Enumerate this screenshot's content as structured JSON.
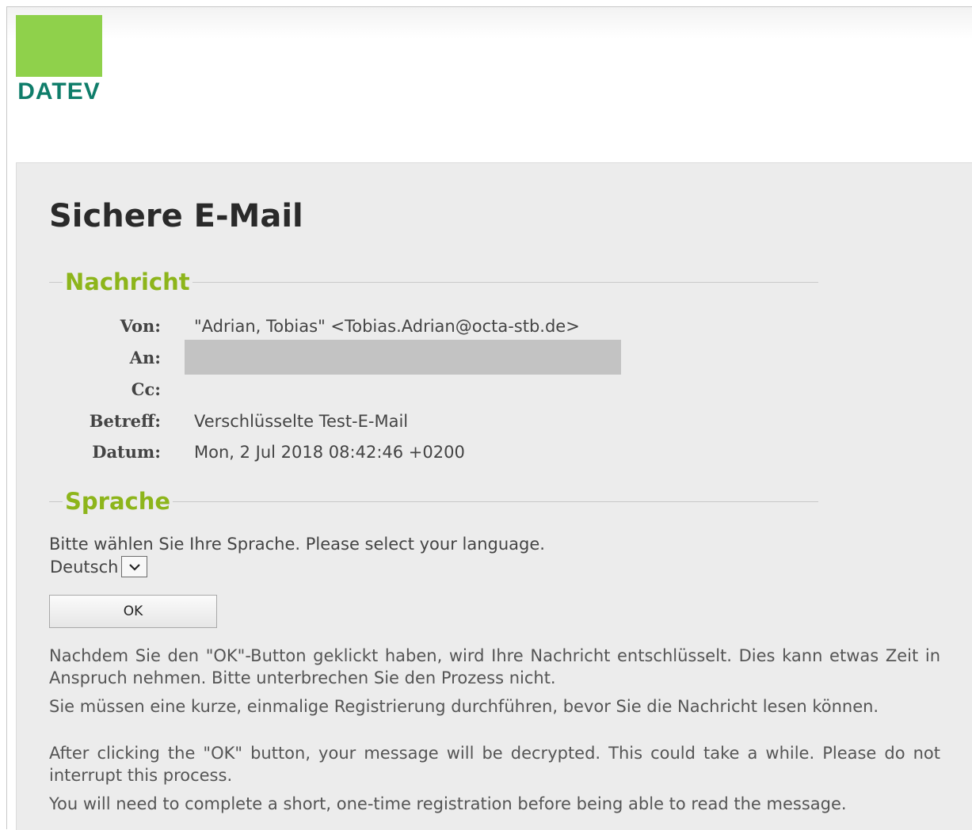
{
  "logo": {
    "text": "DATEV",
    "colors": {
      "square": "#8fd14b",
      "text": "#0f7d6a"
    }
  },
  "page": {
    "title": "Sichere E-Mail"
  },
  "message_section": {
    "legend": "Nachricht",
    "fields": {
      "from_label": "Von:",
      "from_value": "\"Adrian, Tobias\" <Tobias.Adrian@octa-stb.de>",
      "to_label": "An:",
      "cc_label": "Cc:",
      "subject_label": "Betreff:",
      "subject_value": "Verschlüsselte Test-E-Mail",
      "date_label": "Datum:",
      "date_value": "Mon, 2 Jul 2018 08:42:46 +0200"
    }
  },
  "language_section": {
    "legend": "Sprache",
    "prompt": "Bitte wählen Sie Ihre Sprache. Please select your language.",
    "selected_language": "Deutsch",
    "dropdown_icon": "chevron-down-icon",
    "ok_label": "OK"
  },
  "info": {
    "de_decrypt": "Nachdem Sie den \"OK\"-Button geklickt haben, wird Ihre Nachricht entschlüsselt. Dies kann etwas Zeit in Anspruch nehmen. Bitte unterbrechen Sie den Prozess nicht.",
    "de_register": "Sie müssen eine kurze, einmalige Registrierung durchführen, bevor Sie die Nachricht lesen können.",
    "en_decrypt": "After clicking the \"OK\" button, your message will be decrypted. This could take a while. Please do not interrupt this process.",
    "en_register": "You will need to complete a short, one-time registration before being able to read the message."
  },
  "colors": {
    "accent_green": "#8db51b",
    "panel_bg": "#ececec"
  }
}
